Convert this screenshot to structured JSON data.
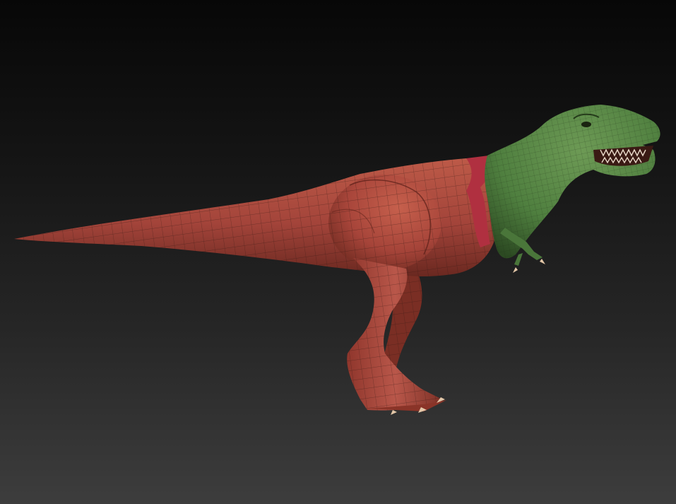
{
  "viewport": {
    "background_top": "#070707",
    "background_bottom": "#3d3d3d"
  },
  "model": {
    "subject": "t-rex-sculpt",
    "polygroup_colors": {
      "body": "#b04a3a",
      "body_shadow": "#6e2a20",
      "neck_band": "#b03040",
      "head_neck": "#4f7f3f",
      "head_shadow": "#2c4a22",
      "claws": "#e4c7a8",
      "wire": "#2a1510"
    }
  }
}
